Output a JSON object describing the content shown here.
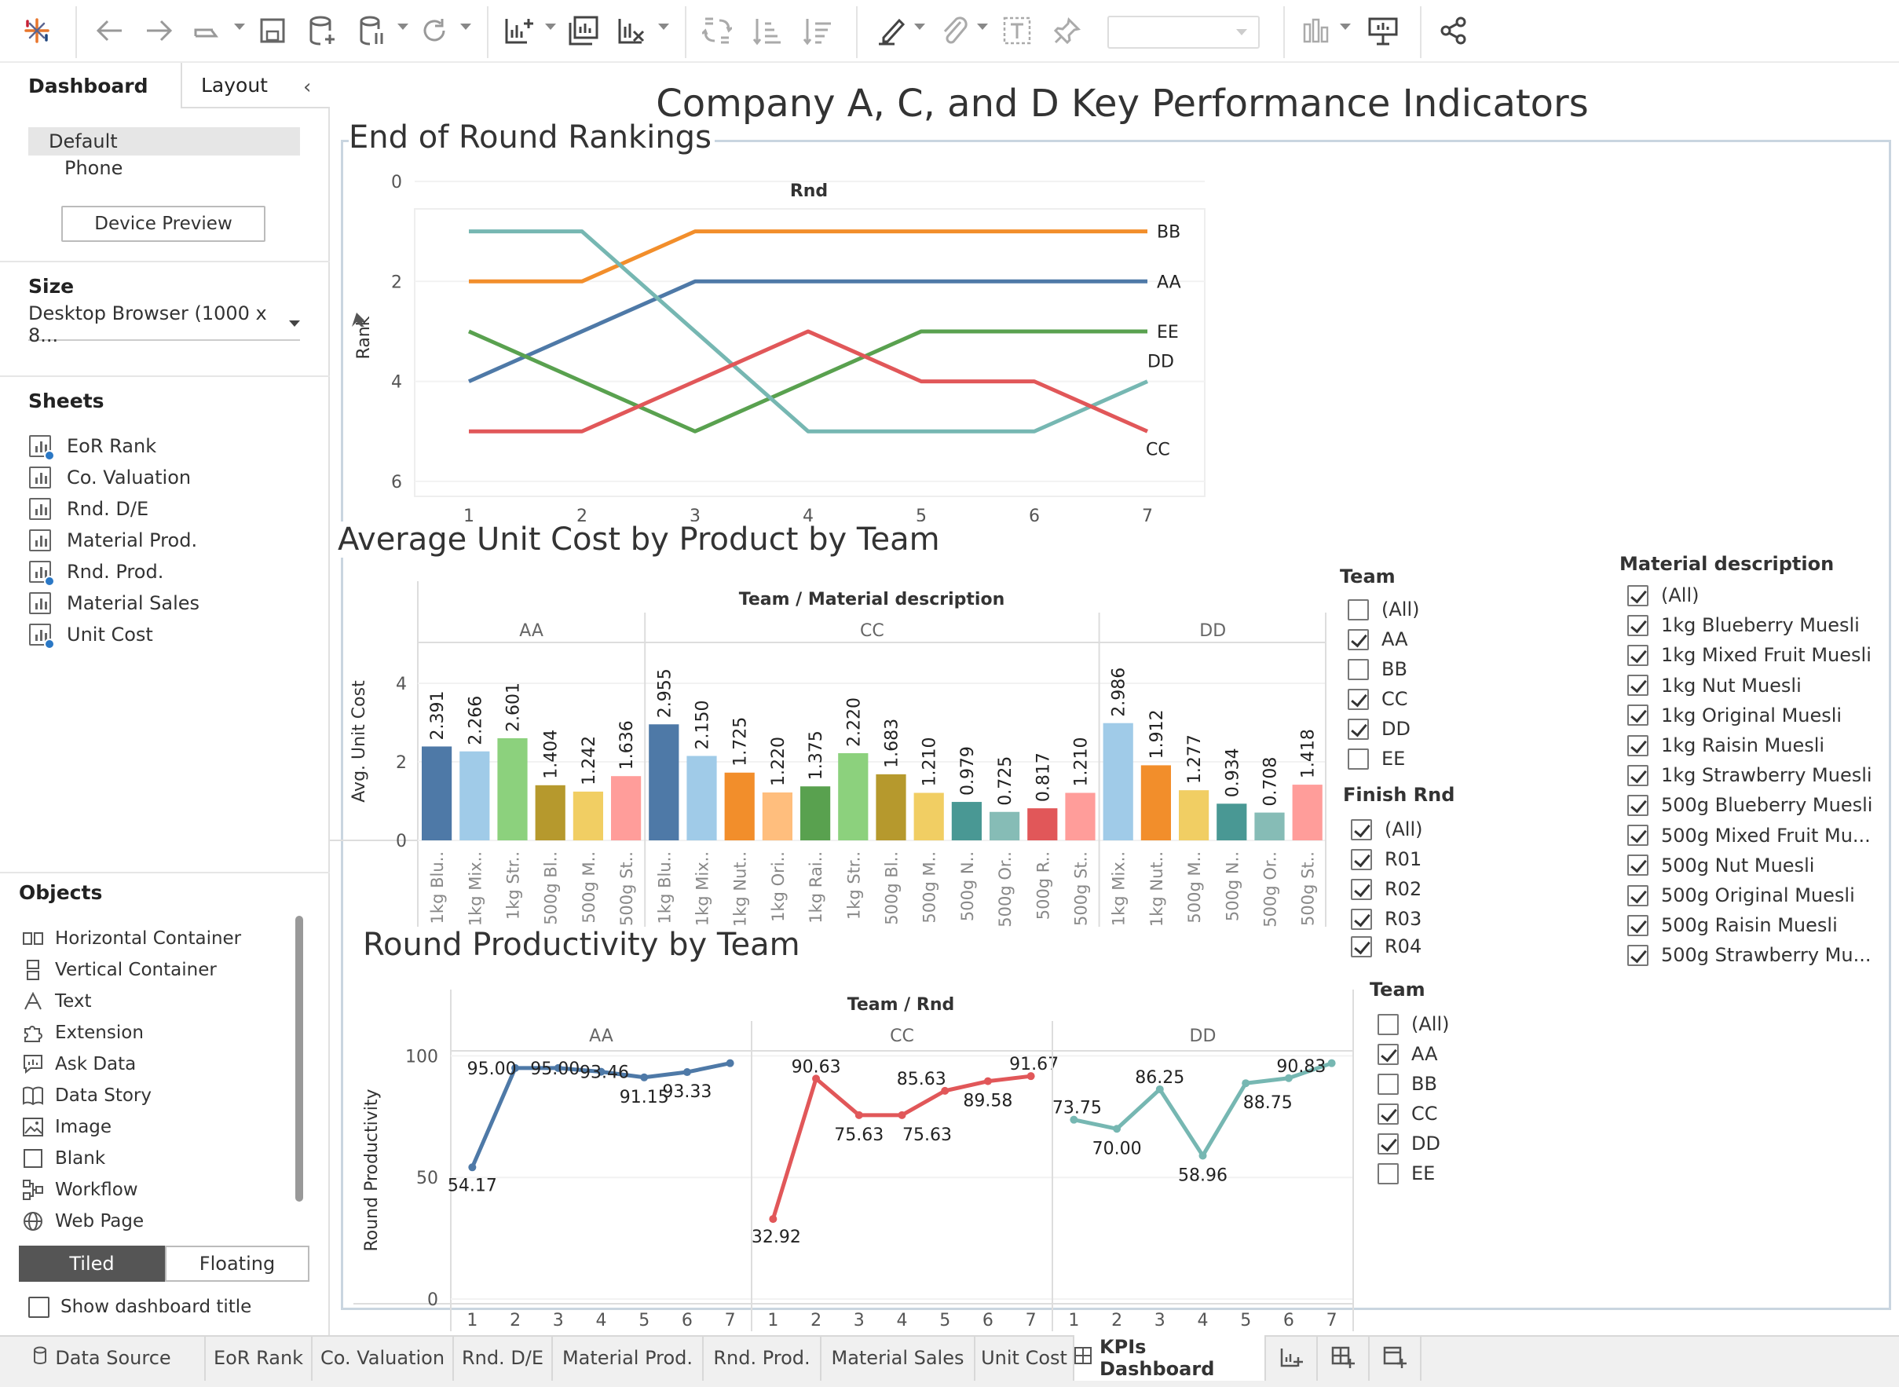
{
  "toolbar": {
    "icons": [
      "tableau-logo",
      "back-arrow",
      "forward-arrow",
      "redo-arrow",
      "save",
      "new-data-source",
      "pause-update",
      "refresh",
      "new-worksheet",
      "duplicate-sheet",
      "clear-sheet",
      "swap",
      "sort-ascending",
      "sort-descending",
      "highlight",
      "group",
      "label",
      "fix-axes",
      "show-me",
      "presentation",
      "share"
    ]
  },
  "left_panel": {
    "tabs": {
      "dashboard": "Dashboard",
      "layout": "Layout"
    },
    "devices": {
      "default": "Default",
      "phone": "Phone"
    },
    "device_preview": "Device Preview",
    "size_title": "Size",
    "size_value": "Desktop Browser (1000 x 8...",
    "sheets_title": "Sheets",
    "sheets": [
      "EoR Rank",
      "Co. Valuation",
      "Rnd. D/E",
      "Material Prod.",
      "Rnd. Prod.",
      "Material Sales",
      "Unit Cost"
    ],
    "objects_title": "Objects",
    "objects": [
      "Horizontal Container",
      "Vertical Container",
      "Text",
      "Extension",
      "Ask Data",
      "Data Story",
      "Image",
      "Blank",
      "Workflow",
      "Web Page"
    ],
    "tiled": "Tiled",
    "floating": "Floating",
    "show_title": "Show dashboard title"
  },
  "dashboard": {
    "title": "Company A, C, and D Key Performance Indicators"
  },
  "rank_chart": {
    "title": "End of Round Rankings",
    "header": "Rnd",
    "ylabel": "Rank",
    "yticks": [
      "0",
      "2",
      "4",
      "6"
    ],
    "xticks": [
      "1",
      "2",
      "3",
      "4",
      "5",
      "6",
      "7"
    ]
  },
  "cost_chart": {
    "title": "Average Unit Cost by Product by Team",
    "header": "Team / Material description",
    "ylabel": "Avg. Unit Cost",
    "yticks": [
      "0",
      "2",
      "4"
    ]
  },
  "prod_chart": {
    "title": "Round Productivity by Team",
    "header": "Team / Rnd",
    "ylabel": "Round Productivity",
    "yticks": [
      "0",
      "50",
      "100"
    ]
  },
  "filters": {
    "team1": {
      "title": "Team",
      "items": [
        {
          "label": "(All)",
          "on": false
        },
        {
          "label": "AA",
          "on": true
        },
        {
          "label": "BB",
          "on": false
        },
        {
          "label": "CC",
          "on": true
        },
        {
          "label": "DD",
          "on": true
        },
        {
          "label": "EE",
          "on": false
        }
      ]
    },
    "finish": {
      "title": "Finish Rnd",
      "items": [
        {
          "label": "(All)",
          "on": true
        },
        {
          "label": "R01",
          "on": true
        },
        {
          "label": "R02",
          "on": true
        },
        {
          "label": "R03",
          "on": true
        },
        {
          "label": "R04",
          "on": true
        }
      ]
    },
    "material": {
      "title": "Material description",
      "items": [
        {
          "label": "(All)",
          "on": true
        },
        {
          "label": "1kg Blueberry Muesli",
          "on": true
        },
        {
          "label": "1kg Mixed Fruit Muesli",
          "on": true
        },
        {
          "label": "1kg Nut Muesli",
          "on": true
        },
        {
          "label": "1kg Original Muesli",
          "on": true
        },
        {
          "label": "1kg Raisin Muesli",
          "on": true
        },
        {
          "label": "1kg Strawberry Muesli",
          "on": true
        },
        {
          "label": "500g Blueberry Muesli",
          "on": true
        },
        {
          "label": "500g Mixed Fruit Mu...",
          "on": true
        },
        {
          "label": "500g Nut Muesli",
          "on": true
        },
        {
          "label": "500g Original Muesli",
          "on": true
        },
        {
          "label": "500g Raisin Muesli",
          "on": true
        },
        {
          "label": "500g Strawberry Mu...",
          "on": true
        }
      ]
    },
    "team2": {
      "title": "Team",
      "items": [
        {
          "label": "(All)",
          "on": false
        },
        {
          "label": "AA",
          "on": true
        },
        {
          "label": "BB",
          "on": false
        },
        {
          "label": "CC",
          "on": true
        },
        {
          "label": "DD",
          "on": true
        },
        {
          "label": "EE",
          "on": false
        }
      ]
    }
  },
  "bottom_tabs": [
    "Data Source",
    "EoR Rank",
    "Co. Valuation",
    "Rnd. D/E",
    "Material Prod.",
    "Rnd. Prod.",
    "Material Sales",
    "Unit Cost",
    "KPIs Dashboard"
  ],
  "active_tab": "KPIs Dashboard",
  "chart_data": [
    {
      "type": "line",
      "title": "End of Round Rankings",
      "xlabel": "Rnd",
      "ylabel": "Rank",
      "x": [
        1,
        2,
        3,
        4,
        5,
        6,
        7
      ],
      "ylim": [
        0,
        6
      ],
      "y_reversed": true,
      "series": [
        {
          "name": "BB",
          "color": "#f28e2b",
          "values": [
            2,
            2,
            1,
            1,
            1,
            1,
            1
          ]
        },
        {
          "name": "AA",
          "color": "#4e79a7",
          "values": [
            4,
            3,
            2,
            2,
            2,
            2,
            2
          ]
        },
        {
          "name": "EE",
          "color": "#59a14f",
          "values": [
            3,
            4,
            5,
            4,
            3,
            3,
            3
          ]
        },
        {
          "name": "DD",
          "color": "#76b7b2",
          "values": [
            1,
            1,
            3,
            5,
            5,
            5,
            4
          ]
        },
        {
          "name": "CC",
          "color": "#e15759",
          "values": [
            5,
            5,
            4,
            3,
            4,
            4,
            5
          ]
        }
      ]
    },
    {
      "type": "bar",
      "title": "Average Unit Cost by Product by Team",
      "ylabel": "Avg. Unit Cost",
      "ylim": [
        0,
        4.8
      ],
      "groups": [
        {
          "team": "AA",
          "bars": [
            {
              "label": "1kg Blu..",
              "value": 2.391,
              "text": "2.391",
              "color": "#4e79a7"
            },
            {
              "label": "1kg Mix..",
              "value": 2.266,
              "text": "2.266",
              "color": "#a0cbe8"
            },
            {
              "label": "1kg Str..",
              "value": 2.601,
              "text": "2.601",
              "color": "#8cd17d"
            },
            {
              "label": "500g Bl..",
              "value": 1.404,
              "text": "1.404",
              "color": "#b6992d"
            },
            {
              "label": "500g M..",
              "value": 1.242,
              "text": "1.242",
              "color": "#f1ce63"
            },
            {
              "label": "500g St..",
              "value": 1.636,
              "text": "1.636",
              "color": "#ff9d9a"
            }
          ]
        },
        {
          "team": "CC",
          "bars": [
            {
              "label": "1kg Blu..",
              "value": 2.955,
              "text": "2.955",
              "color": "#4e79a7"
            },
            {
              "label": "1kg Mix..",
              "value": 2.15,
              "text": "2.150",
              "color": "#a0cbe8"
            },
            {
              "label": "1kg Nut..",
              "value": 1.725,
              "text": "1.725",
              "color": "#f28e2b"
            },
            {
              "label": "1kg Ori..",
              "value": 1.22,
              "text": "1.220",
              "color": "#ffbe7d"
            },
            {
              "label": "1kg Rai..",
              "value": 1.375,
              "text": "1.375",
              "color": "#59a14f"
            },
            {
              "label": "1kg Str..",
              "value": 2.22,
              "text": "2.220",
              "color": "#8cd17d"
            },
            {
              "label": "500g Bl..",
              "value": 1.683,
              "text": "1.683",
              "color": "#b6992d"
            },
            {
              "label": "500g M..",
              "value": 1.21,
              "text": "1.210",
              "color": "#f1ce63"
            },
            {
              "label": "500g N..",
              "value": 0.979,
              "text": "0.979",
              "color": "#499894"
            },
            {
              "label": "500g Or..",
              "value": 0.725,
              "text": "0.725",
              "color": "#86bcb6"
            },
            {
              "label": "500g R..",
              "value": 0.817,
              "text": "0.817",
              "color": "#e15759"
            },
            {
              "label": "500g St..",
              "value": 1.21,
              "text": "1.210",
              "color": "#ff9d9a"
            }
          ]
        },
        {
          "team": "DD",
          "bars": [
            {
              "label": "1kg Mix..",
              "value": 2.986,
              "text": "2.986",
              "color": "#a0cbe8"
            },
            {
              "label": "1kg Nut..",
              "value": 1.912,
              "text": "1.912",
              "color": "#f28e2b"
            },
            {
              "label": "500g M..",
              "value": 1.277,
              "text": "1.277",
              "color": "#f1ce63"
            },
            {
              "label": "500g N..",
              "value": 0.934,
              "text": "0.934",
              "color": "#499894"
            },
            {
              "label": "500g Or..",
              "value": 0.708,
              "text": "0.708",
              "color": "#86bcb6"
            },
            {
              "label": "500g St..",
              "value": 1.418,
              "text": "1.418",
              "color": "#ff9d9a"
            }
          ]
        }
      ]
    },
    {
      "type": "line",
      "title": "Round Productivity by Team",
      "ylabel": "Round Productivity",
      "ylim": [
        0,
        100
      ],
      "x": [
        1,
        2,
        3,
        4,
        5,
        6,
        7
      ],
      "panels": [
        {
          "team": "AA",
          "color": "#4e79a7",
          "values": [
            54.17,
            95.0,
            95.0,
            93.46,
            91.15,
            93.33,
            97.0
          ],
          "labels": [
            "54.17",
            "95.00",
            "95.00",
            "93.46",
            "91.15",
            "93.33",
            ""
          ]
        },
        {
          "team": "CC",
          "color": "#e15759",
          "values": [
            32.92,
            90.63,
            75.63,
            75.63,
            85.63,
            89.58,
            91.67
          ],
          "labels": [
            "32.92",
            "90.63",
            "75.63",
            "75.63",
            "85.63",
            "89.58",
            "91.67"
          ]
        },
        {
          "team": "DD",
          "color": "#76b7b2",
          "values": [
            73.75,
            70.0,
            86.25,
            58.96,
            88.75,
            90.83,
            97.0
          ],
          "labels": [
            "73.75",
            "70.00",
            "86.25",
            "58.96",
            "88.75",
            "90.83",
            ""
          ]
        }
      ]
    }
  ]
}
